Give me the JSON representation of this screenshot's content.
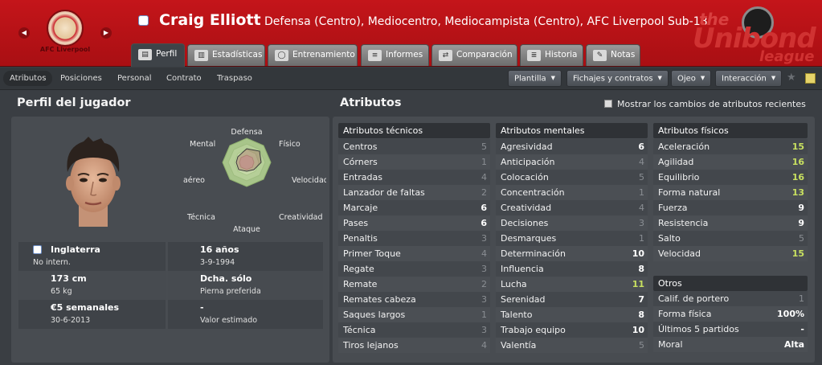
{
  "header": {
    "club_badge_text": "AFC Liverpool",
    "player_name": "Craig Elliott",
    "player_positions": "Defensa (Centro), Mediocentro, Mediocampista (Centro), AFC Liverpool Sub-18",
    "league_logo": {
      "line1": "the",
      "line2": "Unibond",
      "line3": "league"
    },
    "accent_color": "#c4151a"
  },
  "tabs": [
    {
      "label": "Perfil",
      "icon": "profile-card-icon",
      "active": true
    },
    {
      "label": "Estadísticas",
      "icon": "stats-bars-icon"
    },
    {
      "label": "Entrenamiento",
      "icon": "training-ball-icon"
    },
    {
      "label": "Informes",
      "icon": "report-icon"
    },
    {
      "label": "Comparación",
      "icon": "compare-icon"
    },
    {
      "label": "Historia",
      "icon": "history-icon"
    },
    {
      "label": "Notas",
      "icon": "notes-icon"
    }
  ],
  "subnav": {
    "items": [
      "Atributos",
      "Posiciones",
      "Personal",
      "Contrato",
      "Traspaso"
    ],
    "active": "Atributos",
    "dropdowns": [
      "Plantilla",
      "Fichajes y contratos",
      "Ojeo",
      "Interacción"
    ]
  },
  "profile": {
    "title": "Perfil del jugador",
    "radar_labels": {
      "top": "Defensa",
      "top_right": "Físico",
      "right": "Velocidad",
      "bottom_right": "Creatividad",
      "bottom": "Ataque",
      "bottom_left": "Técnica",
      "left": "Juego aéreo",
      "top_left": "Mental"
    },
    "nationality": "Inglaterra",
    "intl": "No intern.",
    "age": "16 años",
    "dob": "3-9-1994",
    "height": "173 cm",
    "weight": "65 kg",
    "foot": "Dcha. sólo",
    "foot_label": "Pierna preferida",
    "wage": "€5 semanales",
    "contract_end": "30-6-2013",
    "value": "-",
    "value_label": "Valor estimado"
  },
  "attributes": {
    "title": "Atributos",
    "show_changes_label": "Mostrar los cambios de atributos recientes",
    "highlight_color": "#c8e060",
    "technical": {
      "heading": "Atributos técnicos",
      "rows": [
        {
          "name": "Centros",
          "value": "5"
        },
        {
          "name": "Córners",
          "value": "1"
        },
        {
          "name": "Entradas",
          "value": "4"
        },
        {
          "name": "Lanzador de faltas",
          "value": "2"
        },
        {
          "name": "Marcaje",
          "value": "6"
        },
        {
          "name": "Pases",
          "value": "6"
        },
        {
          "name": "Penaltis",
          "value": "3"
        },
        {
          "name": "Primer Toque",
          "value": "4"
        },
        {
          "name": "Regate",
          "value": "3"
        },
        {
          "name": "Remate",
          "value": "2"
        },
        {
          "name": "Remates cabeza",
          "value": "3"
        },
        {
          "name": "Saques largos",
          "value": "1"
        },
        {
          "name": "Técnica",
          "value": "3"
        },
        {
          "name": "Tiros lejanos",
          "value": "4"
        }
      ]
    },
    "mental": {
      "heading": "Atributos mentales",
      "rows": [
        {
          "name": "Agresividad",
          "value": "6"
        },
        {
          "name": "Anticipación",
          "value": "4"
        },
        {
          "name": "Colocación",
          "value": "5"
        },
        {
          "name": "Concentración",
          "value": "1"
        },
        {
          "name": "Creatividad",
          "value": "4"
        },
        {
          "name": "Decisiones",
          "value": "3"
        },
        {
          "name": "Desmarques",
          "value": "1"
        },
        {
          "name": "Determinación",
          "value": "10"
        },
        {
          "name": "Influencia",
          "value": "8"
        },
        {
          "name": "Lucha",
          "value": "11"
        },
        {
          "name": "Serenidad",
          "value": "7"
        },
        {
          "name": "Talento",
          "value": "8"
        },
        {
          "name": "Trabajo equipo",
          "value": "10"
        },
        {
          "name": "Valentía",
          "value": "5"
        }
      ]
    },
    "physical": {
      "heading": "Atributos físicos",
      "rows": [
        {
          "name": "Aceleración",
          "value": "15"
        },
        {
          "name": "Agilidad",
          "value": "16"
        },
        {
          "name": "Equilibrio",
          "value": "16"
        },
        {
          "name": "Forma natural",
          "value": "13"
        },
        {
          "name": "Fuerza",
          "value": "9"
        },
        {
          "name": "Resistencia",
          "value": "9"
        },
        {
          "name": "Salto",
          "value": "5"
        },
        {
          "name": "Velocidad",
          "value": "15"
        }
      ]
    },
    "other": {
      "heading": "Otros",
      "rows": [
        {
          "name": "Calif. de portero",
          "value": "1"
        },
        {
          "name": "Forma física",
          "value": "100%"
        },
        {
          "name": "Últimos 5 partidos",
          "value": "-"
        },
        {
          "name": "Moral",
          "value": "Alta"
        }
      ]
    }
  }
}
